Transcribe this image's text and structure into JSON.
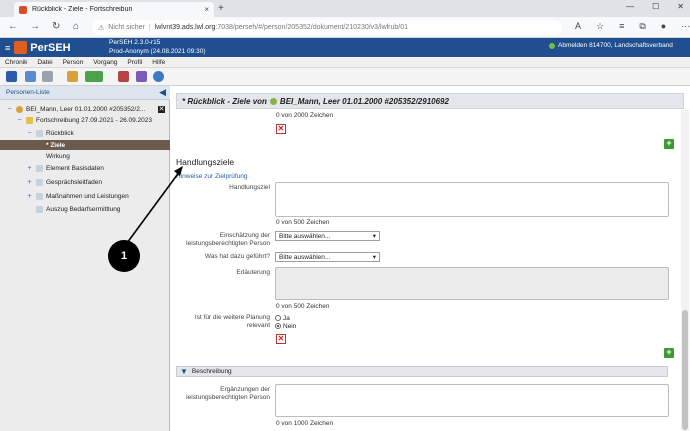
{
  "browser": {
    "tab_title": "Rückblick - Ziele - Fortschreibun",
    "tab_close": "×",
    "new_tab": "+",
    "win_min": "—",
    "win_max": "☐",
    "win_close": "✕",
    "back": "←",
    "forward": "→",
    "reload": "↻",
    "home": "⌂",
    "security_label": "Nicht sicher",
    "url_host": "lwlvnt39.ads.lwl.org",
    "url_path": ":7038/perseh/#/person/205352/dokument/210230/v3/lwlrub/01",
    "more": "⋯"
  },
  "app": {
    "name": "PerSEH",
    "version_line": "PerSEH 2.3.0-r15",
    "env_line": "Prod-Anonym (24.08.2021 09:30)",
    "logout_text": "Abmelden 814700, Landschaftsverband"
  },
  "menu": [
    "Chronik",
    "Datei",
    "Person",
    "Vorgang",
    "Profil",
    "Hilfe"
  ],
  "left_panel": {
    "title": "Personen-Liste",
    "collapse": "◀",
    "tree": {
      "person": "BEI_Mann, Leer 01.01.2000 #205352/2...",
      "fortschreibung": "Fortschreibung 27.09.2021 - 26.09.2023",
      "rueckblick": "Rückblick",
      "ziele": "* Ziele",
      "wirkung": "Wirkung",
      "element_basisdaten": "Element Basisdaten",
      "gespraechsleitfaden": "Gesprächsleitfaden",
      "massnahmen": "Maßnahmen und Leistungen",
      "auszug": "Auszug Bedarfsermittlung",
      "close_x": "✕",
      "minus": "−",
      "plus": "+"
    }
  },
  "content": {
    "title": "* Rückblick - Ziele von",
    "title_person": "BEI_Mann, Leer 01.01.2000 #205352/2910692",
    "counter_top": "0 von 2000 Zeichen",
    "section_title": "Handlungsziele",
    "hinweise_link": "Hinweise zur Zielprüfung",
    "handlungsziel_label": "Handlungsziel",
    "counter_handlungsziel": "0 von 500 Zeichen",
    "einschaetzung_label": "Einschätzung der leistungsberechtigten Person",
    "einschaetzung_value": "Bitte auswählen...",
    "dazu_label": "Was hat dazu geführt?",
    "dazu_value": "Bitte auswählen...",
    "erlaeuterung_label": "Erläuterung",
    "counter_erlaeuterung": "0 von 500 Zeichen",
    "planung_label": "Ist für die weitere Planung relevant",
    "radio_ja": "Ja",
    "radio_nein": "Nein",
    "beschreibung_header": "Beschreibung",
    "ergaenzungen_label": "Ergänzungen der leistungsberechtigten Person",
    "counter_ergaenzungen": "0 von 1000 Zeichen",
    "delete_glyph": "✕",
    "add_glyph": "+",
    "dropdown_glyph": "▾",
    "chevron_glyph": "▼"
  },
  "annotation": {
    "callout_number": "1"
  },
  "colors": {
    "header_blue": "#1f4f8f",
    "accent_orange": "#e35d1d",
    "selected_row": "#6b5a4e",
    "add_green": "#3c9a2e",
    "delete_red": "#c22222"
  }
}
